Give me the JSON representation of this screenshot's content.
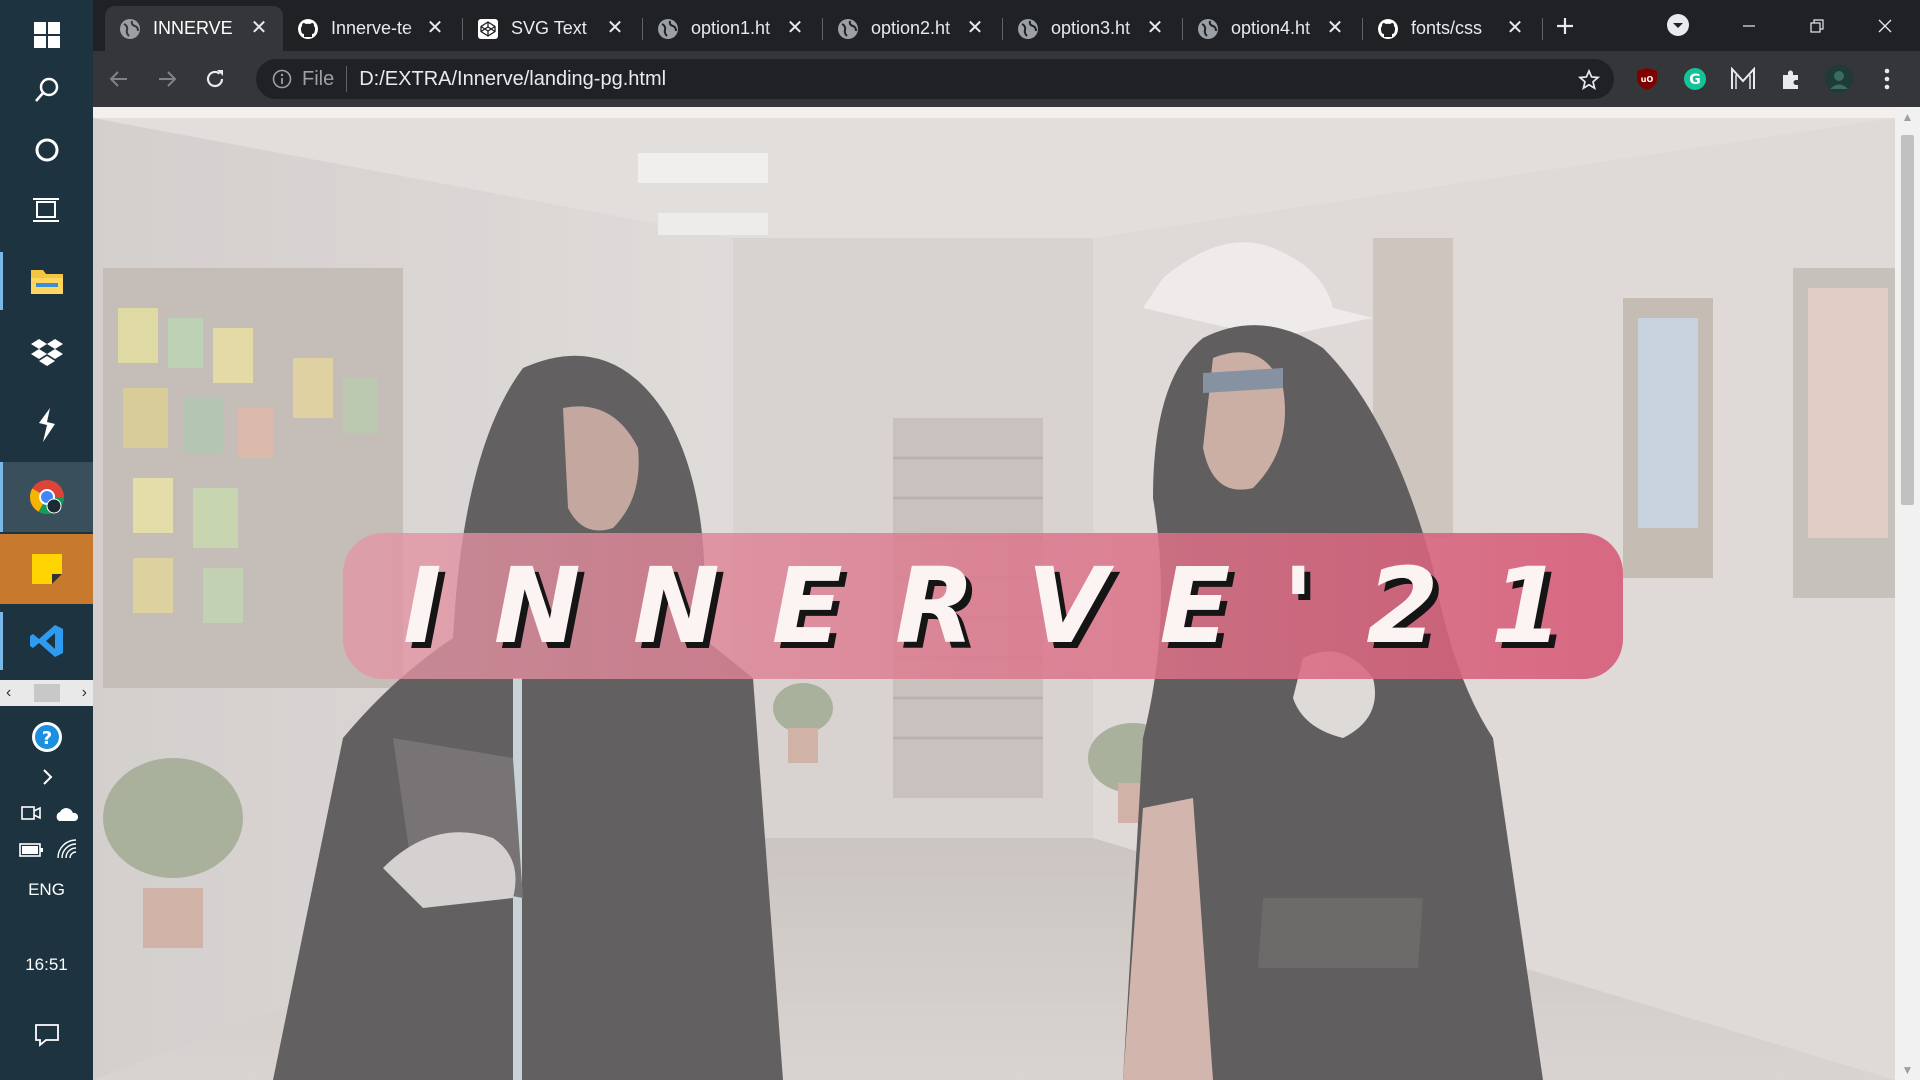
{
  "taskbar": {
    "language": "ENG",
    "time": "16:51",
    "icons": [
      "windows-start-icon",
      "search-icon",
      "cortana-icon",
      "task-view-icon",
      "file-explorer-icon",
      "dropbox-icon",
      "stack-app-icon",
      "chrome-icon",
      "sticky-notes-icon",
      "vscode-icon",
      "help-icon",
      "chevron-right-icon",
      "meet-now-icon",
      "onedrive-icon",
      "battery-icon",
      "wifi-icon",
      "notification-icon"
    ]
  },
  "browser": {
    "tabs": [
      {
        "title": "INNERVE",
        "icon": "globe-icon",
        "active": true
      },
      {
        "title": "Innerve-te",
        "icon": "github-icon"
      },
      {
        "title": "SVG Text",
        "icon": "codepen-icon"
      },
      {
        "title": "option1.ht",
        "icon": "globe-icon"
      },
      {
        "title": "option2.ht",
        "icon": "globe-icon"
      },
      {
        "title": "option3.ht",
        "icon": "globe-icon"
      },
      {
        "title": "option4.ht",
        "icon": "globe-icon"
      },
      {
        "title": "fonts/css",
        "icon": "github-icon"
      }
    ],
    "address": {
      "scheme_label": "File",
      "url": "D:/EXTRA/Innerve/landing-pg.html"
    },
    "extensions": [
      "ublock-icon",
      "grammarly-icon",
      "m-extension-icon",
      "extensions-puzzle-icon",
      "profile-avatar-icon",
      "menu-kebab-icon"
    ]
  },
  "page": {
    "banner_text": "INNERVE'21",
    "colors": {
      "banner_start": "#e296a5",
      "banner_end": "#d65c78",
      "text": "#fbf4f2",
      "text_shadow": "#151515"
    }
  }
}
